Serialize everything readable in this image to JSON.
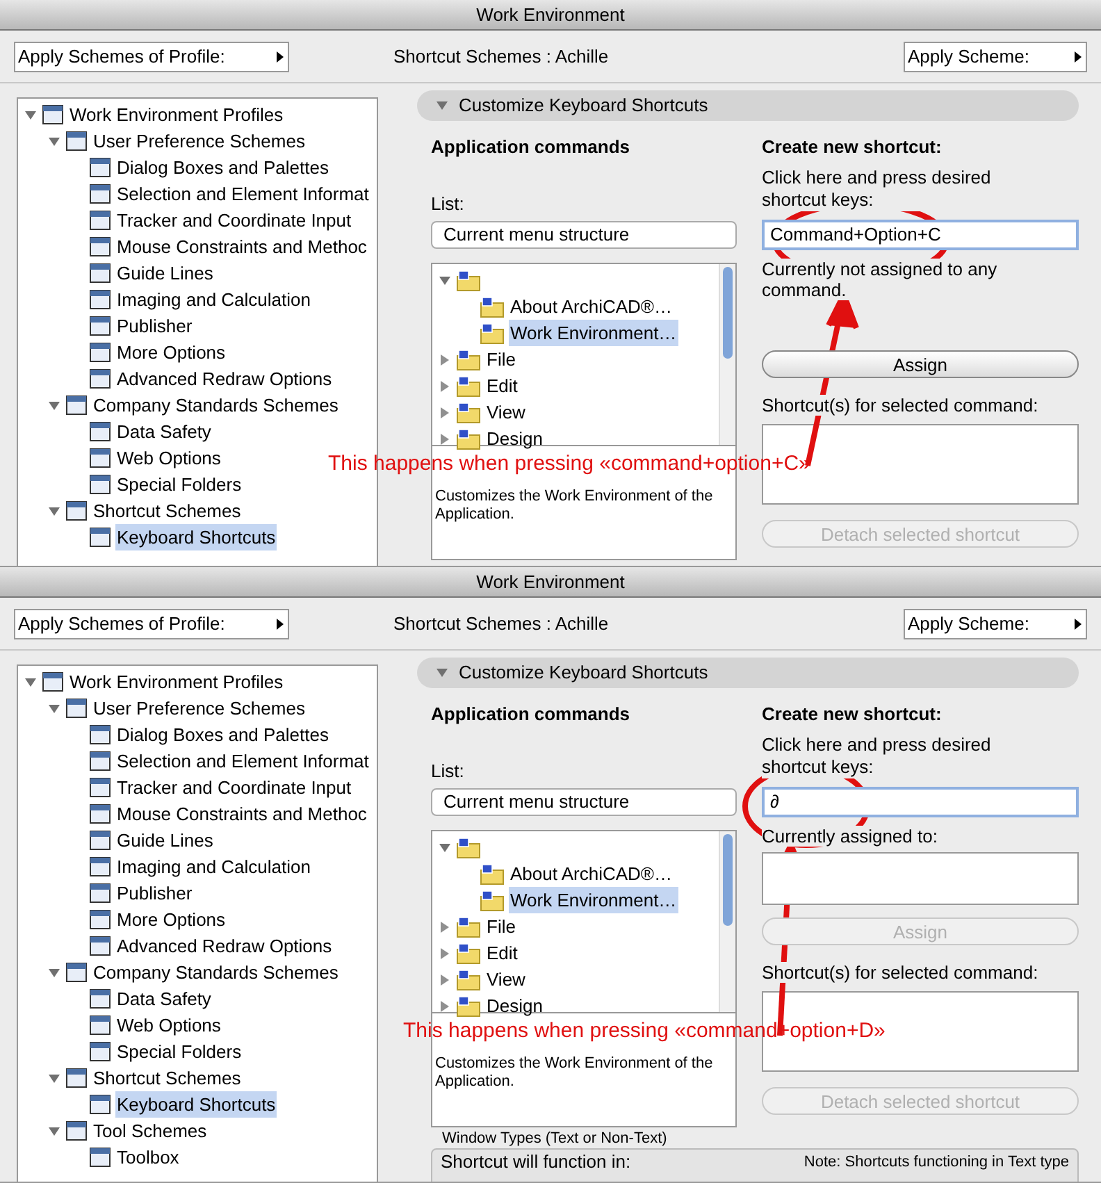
{
  "panels": [
    {
      "window": {
        "title": "Work Environment"
      },
      "toolbar": {
        "profile_menu": "Apply Schemes of Profile:",
        "scheme_label": "Shortcut Schemes : Achille",
        "apply_menu": "Apply Scheme:"
      },
      "tree": [
        {
          "label": "Work Environment Profiles",
          "expanded": true,
          "children": [
            {
              "label": "User Preference Schemes",
              "expanded": true,
              "children": [
                {
                  "label": "Dialog Boxes and Palettes",
                  "selected": false
                },
                {
                  "label": "Selection and Element Informat",
                  "selected": false
                },
                {
                  "label": "Tracker and Coordinate Input",
                  "selected": false
                },
                {
                  "label": "Mouse Constraints and Methoc",
                  "selected": false
                },
                {
                  "label": "Guide Lines",
                  "selected": false
                },
                {
                  "label": "Imaging and Calculation",
                  "selected": false
                },
                {
                  "label": "Publisher",
                  "selected": false
                },
                {
                  "label": "More Options",
                  "selected": false
                },
                {
                  "label": "Advanced Redraw Options",
                  "selected": false
                }
              ]
            },
            {
              "label": "Company Standards Schemes",
              "expanded": true,
              "children": [
                {
                  "label": "Data Safety",
                  "selected": false
                },
                {
                  "label": "Web Options",
                  "selected": false
                },
                {
                  "label": "Special Folders",
                  "selected": false
                }
              ]
            },
            {
              "label": "Shortcut Schemes",
              "expanded": true,
              "children": [
                {
                  "label": "Keyboard Shortcuts",
                  "selected": true
                }
              ]
            }
          ]
        }
      ],
      "section_title": "Customize Keyboard Shortcuts",
      "commands": {
        "heading": "Application commands",
        "list_label": "List:",
        "list_value": "Current menu structure",
        "items": [
          {
            "expanded": true,
            "children": [
              {
                "label": "About ArchiCAD®…",
                "selected": false
              },
              {
                "label": "Work Environment…",
                "selected": true
              }
            ]
          },
          {
            "label": "File",
            "expanded": false
          },
          {
            "label": "Edit",
            "expanded": false
          },
          {
            "label": "View",
            "expanded": false
          },
          {
            "label": "Design",
            "expanded": false
          }
        ],
        "description": "Customizes the Work Environment of the Application."
      },
      "shortcut": {
        "heading": "Create new shortcut:",
        "hint": "Click here and press desired shortcut keys:",
        "value": "Command+Option+C",
        "status": "Currently not assigned to any command.",
        "assigned_list": false,
        "assign": {
          "label": "Assign",
          "disabled": false
        },
        "list_label": "Shortcut(s) for selected command:",
        "detach": {
          "label": "Detach selected shortcut",
          "disabled": true
        }
      },
      "annotation": "This happens when pressing «command+option+C»"
    },
    {
      "window": {
        "title": "Work Environment"
      },
      "toolbar": {
        "profile_menu": "Apply Schemes of Profile:",
        "scheme_label": "Shortcut Schemes : Achille",
        "apply_menu": "Apply Scheme:"
      },
      "tree": [
        {
          "label": "Work Environment Profiles",
          "expanded": true,
          "children": [
            {
              "label": "User Preference Schemes",
              "expanded": true,
              "children": [
                {
                  "label": "Dialog Boxes and Palettes",
                  "selected": false
                },
                {
                  "label": "Selection and Element Informat",
                  "selected": false
                },
                {
                  "label": "Tracker and Coordinate Input",
                  "selected": false
                },
                {
                  "label": "Mouse Constraints and Methoc",
                  "selected": false
                },
                {
                  "label": "Guide Lines",
                  "selected": false
                },
                {
                  "label": "Imaging and Calculation",
                  "selected": false
                },
                {
                  "label": "Publisher",
                  "selected": false
                },
                {
                  "label": "More Options",
                  "selected": false
                },
                {
                  "label": "Advanced Redraw Options",
                  "selected": false
                }
              ]
            },
            {
              "label": "Company Standards Schemes",
              "expanded": true,
              "children": [
                {
                  "label": "Data Safety",
                  "selected": false
                },
                {
                  "label": "Web Options",
                  "selected": false
                },
                {
                  "label": "Special Folders",
                  "selected": false
                }
              ]
            },
            {
              "label": "Shortcut Schemes",
              "expanded": true,
              "children": [
                {
                  "label": "Keyboard Shortcuts",
                  "selected": true
                }
              ]
            },
            {
              "label": "Tool Schemes",
              "expanded": true,
              "children": [
                {
                  "label": "Toolbox",
                  "selected": false
                }
              ]
            }
          ]
        }
      ],
      "section_title": "Customize Keyboard Shortcuts",
      "commands": {
        "heading": "Application commands",
        "list_label": "List:",
        "list_value": "Current menu structure",
        "items": [
          {
            "expanded": true,
            "children": [
              {
                "label": "About ArchiCAD®…",
                "selected": false
              },
              {
                "label": "Work Environment…",
                "selected": true
              }
            ]
          },
          {
            "label": "File",
            "expanded": false
          },
          {
            "label": "Edit",
            "expanded": false
          },
          {
            "label": "View",
            "expanded": false
          },
          {
            "label": "Design",
            "expanded": false
          }
        ],
        "description": "Customizes the Work Environment of the Application."
      },
      "shortcut": {
        "heading": "Create new shortcut:",
        "hint": "Click here and press desired shortcut keys:",
        "value": "∂",
        "status": "Currently assigned to:",
        "assigned_list": true,
        "assign": {
          "label": "Assign",
          "disabled": true
        },
        "list_label": "Shortcut(s) for selected command:",
        "detach": {
          "label": "Detach selected shortcut",
          "disabled": true
        }
      },
      "window_types": {
        "title": "Window Types (Text or Non-Text)",
        "label": "Shortcut will function in:",
        "note": "Note: Shortcuts functioning in Text type"
      },
      "annotation": "This happens when pressing «command+option+D»"
    }
  ]
}
